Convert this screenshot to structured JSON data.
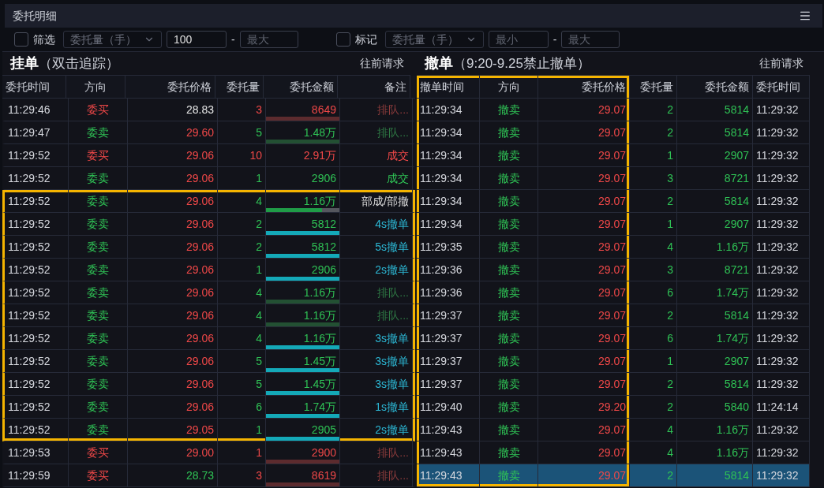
{
  "window": {
    "title": "委托明细"
  },
  "filters": [
    {
      "label": "筛选",
      "checked": false,
      "select": "委托量（手）",
      "min": {
        "value": "100"
      },
      "separator": "-",
      "max": {
        "placeholder": "最大"
      }
    },
    {
      "label": "标记",
      "checked": false,
      "select": "委托量（手）",
      "min": {
        "placeholder": "最小"
      },
      "separator": "-",
      "max": {
        "placeholder": "最大"
      }
    }
  ],
  "pending": {
    "title": "挂单",
    "subtitle": "（双击追踪）",
    "action": "往前请求",
    "columns": [
      "委托时间",
      "方向",
      "委托价格",
      "委托量",
      "委托金额",
      "备注"
    ],
    "rows": [
      {
        "kind": "queue",
        "time": "11:29:46",
        "direction": {
          "text": "委买",
          "color": "#f04848"
        },
        "price": {
          "text": "28.83",
          "color": "#e6e6e6"
        },
        "qty": "3",
        "amount": "8649",
        "level": 1,
        "note": {
          "text": "排队...",
          "color": "#8e3c3c"
        },
        "highlighted": false
      },
      {
        "kind": "queue",
        "time": "11:29:47",
        "direction": {
          "text": "委卖",
          "color": "#2fc255"
        },
        "price": {
          "text": "29.60",
          "color": "#f04848"
        },
        "qty": "5",
        "amount": "1.48万",
        "level": 1,
        "note": {
          "text": "排队...",
          "color": "#2f7a45"
        },
        "highlighted": false
      },
      {
        "kind": "filled",
        "time": "11:29:52",
        "direction": {
          "text": "委买",
          "color": "#f04848"
        },
        "price": {
          "text": "29.06",
          "color": "#f04848"
        },
        "qty": "10",
        "amount": "2.91万",
        "note": {
          "text": "成交",
          "color": "#f04848"
        },
        "highlighted": false
      },
      {
        "kind": "filled",
        "time": "11:29:52",
        "direction": {
          "text": "委卖",
          "color": "#2fc255"
        },
        "price": {
          "text": "29.06",
          "color": "#f04848"
        },
        "qty": "1",
        "amount": "2906",
        "note": {
          "text": "成交",
          "color": "#2fc255"
        },
        "highlighted": false
      },
      {
        "kind": "partial",
        "time": "11:29:52",
        "direction": {
          "text": "委卖",
          "color": "#2fc255"
        },
        "price": {
          "text": "29.06",
          "color": "#f04848"
        },
        "qty": "4",
        "amount": "1.16万",
        "level": 0.76,
        "note": {
          "text": "部成/部撤",
          "color": "#dcdcdc"
        },
        "highlighted": true
      },
      {
        "kind": "cancel",
        "time": "11:29:52",
        "direction": {
          "text": "委卖",
          "color": "#2fc255"
        },
        "price": {
          "text": "29.06",
          "color": "#f04848"
        },
        "qty": "2",
        "amount": "5812",
        "level": 1,
        "note": {
          "text": "4s撤单",
          "color": "#2cb7d4"
        },
        "highlighted": true
      },
      {
        "kind": "cancel",
        "time": "11:29:52",
        "direction": {
          "text": "委卖",
          "color": "#2fc255"
        },
        "price": {
          "text": "29.06",
          "color": "#f04848"
        },
        "qty": "2",
        "amount": "5812",
        "level": 1,
        "note": {
          "text": "5s撤单",
          "color": "#2cb7d4"
        },
        "highlighted": true
      },
      {
        "kind": "cancel",
        "time": "11:29:52",
        "direction": {
          "text": "委卖",
          "color": "#2fc255"
        },
        "price": {
          "text": "29.06",
          "color": "#f04848"
        },
        "qty": "1",
        "amount": "2906",
        "level": 1,
        "note": {
          "text": "2s撤单",
          "color": "#2cb7d4"
        },
        "highlighted": true
      },
      {
        "kind": "queue",
        "time": "11:29:52",
        "direction": {
          "text": "委卖",
          "color": "#2fc255"
        },
        "price": {
          "text": "29.06",
          "color": "#f04848"
        },
        "qty": "4",
        "amount": "1.16万",
        "level": 1,
        "note": {
          "text": "排队...",
          "color": "#2f7a45"
        },
        "highlighted": true
      },
      {
        "kind": "queue",
        "time": "11:29:52",
        "direction": {
          "text": "委卖",
          "color": "#2fc255"
        },
        "price": {
          "text": "29.06",
          "color": "#f04848"
        },
        "qty": "4",
        "amount": "1.16万",
        "level": 1,
        "note": {
          "text": "排队...",
          "color": "#2f7a45"
        },
        "highlighted": true
      },
      {
        "kind": "cancel",
        "time": "11:29:52",
        "direction": {
          "text": "委卖",
          "color": "#2fc255"
        },
        "price": {
          "text": "29.06",
          "color": "#f04848"
        },
        "qty": "4",
        "amount": "1.16万",
        "level": 1,
        "note": {
          "text": "3s撤单",
          "color": "#2cb7d4"
        },
        "highlighted": true
      },
      {
        "kind": "cancel",
        "time": "11:29:52",
        "direction": {
          "text": "委卖",
          "color": "#2fc255"
        },
        "price": {
          "text": "29.06",
          "color": "#f04848"
        },
        "qty": "5",
        "amount": "1.45万",
        "level": 1,
        "note": {
          "text": "3s撤单",
          "color": "#2cb7d4"
        },
        "highlighted": true
      },
      {
        "kind": "cancel",
        "time": "11:29:52",
        "direction": {
          "text": "委卖",
          "color": "#2fc255"
        },
        "price": {
          "text": "29.06",
          "color": "#f04848"
        },
        "qty": "5",
        "amount": "1.45万",
        "level": 1,
        "note": {
          "text": "3s撤单",
          "color": "#2cb7d4"
        },
        "highlighted": true
      },
      {
        "kind": "cancel",
        "time": "11:29:52",
        "direction": {
          "text": "委卖",
          "color": "#2fc255"
        },
        "price": {
          "text": "29.06",
          "color": "#f04848"
        },
        "qty": "6",
        "amount": "1.74万",
        "level": 1,
        "note": {
          "text": "1s撤单",
          "color": "#2cb7d4"
        },
        "highlighted": true
      },
      {
        "kind": "cancel",
        "time": "11:29:52",
        "direction": {
          "text": "委卖",
          "color": "#2fc255"
        },
        "price": {
          "text": "29.05",
          "color": "#f04848"
        },
        "qty": "1",
        "amount": "2905",
        "level": 1,
        "note": {
          "text": "2s撤单",
          "color": "#2cb7d4"
        },
        "highlighted": true
      },
      {
        "kind": "queue",
        "time": "11:29:53",
        "direction": {
          "text": "委买",
          "color": "#f04848"
        },
        "price": {
          "text": "29.00",
          "color": "#f04848"
        },
        "qty": "1",
        "amount": "2900",
        "level": 1,
        "note": {
          "text": "排队...",
          "color": "#8e3c3c"
        },
        "highlighted": false
      },
      {
        "kind": "queue",
        "time": "11:29:59",
        "direction": {
          "text": "委买",
          "color": "#f04848"
        },
        "price": {
          "text": "28.73",
          "color": "#2fc255"
        },
        "qty": "3",
        "amount": "8619",
        "level": 1,
        "note": {
          "text": "排队...",
          "color": "#8e3c3c"
        },
        "highlighted": false
      }
    ]
  },
  "cancelled": {
    "title": "撤单",
    "subtitle": "（9:20-9.25禁止撤单）",
    "action": "往前请求",
    "columns": [
      {
        "label": "撤单时间",
        "highlighted": true
      },
      {
        "label": "方向",
        "highlighted": true
      },
      {
        "label": "委托价格",
        "highlighted": true
      },
      {
        "label": "委托量",
        "highlighted": false
      },
      {
        "label": "委托金额",
        "highlighted": false
      },
      {
        "label": "委托时间",
        "highlighted": false
      }
    ],
    "rows": [
      {
        "time": "11:29:34",
        "direction": "撤卖",
        "price": "29.07",
        "qty": "2",
        "amount": "5814",
        "order_time": "11:29:32",
        "selected": false
      },
      {
        "time": "11:29:34",
        "direction": "撤卖",
        "price": "29.07",
        "qty": "2",
        "amount": "5814",
        "order_time": "11:29:32",
        "selected": false
      },
      {
        "time": "11:29:34",
        "direction": "撤卖",
        "price": "29.07",
        "qty": "1",
        "amount": "2907",
        "order_time": "11:29:32",
        "selected": false
      },
      {
        "time": "11:29:34",
        "direction": "撤卖",
        "price": "29.07",
        "qty": "3",
        "amount": "8721",
        "order_time": "11:29:32",
        "selected": false
      },
      {
        "time": "11:29:34",
        "direction": "撤卖",
        "price": "29.07",
        "qty": "2",
        "amount": "5814",
        "order_time": "11:29:32",
        "selected": false
      },
      {
        "time": "11:29:34",
        "direction": "撤卖",
        "price": "29.07",
        "qty": "1",
        "amount": "2907",
        "order_time": "11:29:32",
        "selected": false
      },
      {
        "time": "11:29:35",
        "direction": "撤卖",
        "price": "29.07",
        "qty": "4",
        "amount": "1.16万",
        "order_time": "11:29:32",
        "selected": false
      },
      {
        "time": "11:29:36",
        "direction": "撤卖",
        "price": "29.07",
        "qty": "3",
        "amount": "8721",
        "order_time": "11:29:32",
        "selected": false
      },
      {
        "time": "11:29:36",
        "direction": "撤卖",
        "price": "29.07",
        "qty": "6",
        "amount": "1.74万",
        "order_time": "11:29:32",
        "selected": false
      },
      {
        "time": "11:29:37",
        "direction": "撤卖",
        "price": "29.07",
        "qty": "2",
        "amount": "5814",
        "order_time": "11:29:32",
        "selected": false
      },
      {
        "time": "11:29:37",
        "direction": "撤卖",
        "price": "29.07",
        "qty": "6",
        "amount": "1.74万",
        "order_time": "11:29:32",
        "selected": false
      },
      {
        "time": "11:29:37",
        "direction": "撤卖",
        "price": "29.07",
        "qty": "1",
        "amount": "2907",
        "order_time": "11:29:32",
        "selected": false
      },
      {
        "time": "11:29:37",
        "direction": "撤卖",
        "price": "29.07",
        "qty": "2",
        "amount": "5814",
        "order_time": "11:29:32",
        "selected": false
      },
      {
        "time": "11:29:40",
        "direction": "撤卖",
        "price": "29.20",
        "qty": "2",
        "amount": "5840",
        "order_time": "11:24:14",
        "selected": false
      },
      {
        "time": "11:29:43",
        "direction": "撤卖",
        "price": "29.07",
        "qty": "4",
        "amount": "1.16万",
        "order_time": "11:29:32",
        "selected": false
      },
      {
        "time": "11:29:43",
        "direction": "撤卖",
        "price": "29.07",
        "qty": "4",
        "amount": "1.16万",
        "order_time": "11:29:32",
        "selected": false
      },
      {
        "time": "11:29:43",
        "direction": "撤卖",
        "price": "29.07",
        "qty": "2",
        "amount": "5814",
        "order_time": "11:29:32",
        "selected": true
      }
    ]
  }
}
